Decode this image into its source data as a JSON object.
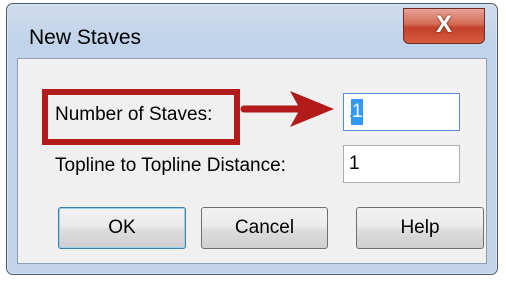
{
  "window": {
    "title": "New Staves",
    "close_glyph": "X",
    "close_icon": "close-icon"
  },
  "form": {
    "num_staves_label": "Number of Staves:",
    "num_staves_value": "1",
    "topline_label": "Topline to Topline Distance:",
    "topline_value": "1"
  },
  "annotation": {
    "highlight_color": "#b31b1b",
    "arrow_icon": "arrow-right-icon"
  },
  "buttons": {
    "ok_label": "OK",
    "cancel_label": "Cancel",
    "help_label": "Help"
  }
}
